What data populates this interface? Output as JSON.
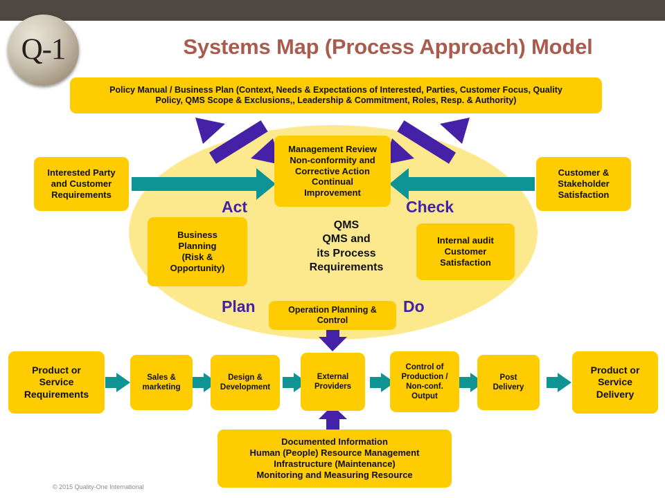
{
  "header": {
    "logo_text": "Q-1",
    "title": "Systems Map (Process Approach) Model"
  },
  "policy_box": {
    "line1": "Policy Manual / Business Plan (Context, Needs & Expectations of Interested, Parties, Customer Focus, Quality",
    "line2": "Policy, QMS Scope & Exclusions,, Leadership & Commitment, Roles, Resp. & Authority)"
  },
  "center": {
    "management_review": "Management Review\nNon-conformity and\nCorrective Action\nContinual\nImprovement",
    "qms_line1": "QMS",
    "qms_line2": "QMS and",
    "qms_line3": "its Process",
    "qms_line4": "Requirements"
  },
  "pdca": {
    "act": "Act",
    "check": "Check",
    "plan": "Plan",
    "do": "Do"
  },
  "side_boxes": {
    "interested_party": "Interested Party\nand Customer\nRequirements",
    "customer_satisfaction": "Customer &\nStakeholder\nSatisfaction",
    "business_planning": "Business\nPlanning\n(Risk &\nOpportunity)",
    "internal_audit": "Internal audit\nCustomer\nSatisfaction",
    "operation_planning": "Operation Planning &\nControl"
  },
  "process_chain": [
    {
      "label": "Product or\nService\nRequirements",
      "emphasis": "large"
    },
    {
      "label": "Sales &\nmarketing",
      "emphasis": "small"
    },
    {
      "label": "Design &\nDevelopment",
      "emphasis": "small"
    },
    {
      "label": "External\nProviders",
      "emphasis": "small"
    },
    {
      "label": "Control of\nProduction /\nNon-conf.\nOutput",
      "emphasis": "small"
    },
    {
      "label": "Post\nDelivery",
      "emphasis": "small"
    },
    {
      "label": "Product or\nService\nDelivery",
      "emphasis": "large"
    }
  ],
  "support_box": {
    "line1": "Documented Information",
    "line2": "Human (People) Resource Management",
    "line3": "Infrastructure (Maintenance)",
    "line4": "Monitoring and Measuring Resource"
  },
  "footer": {
    "copyright": "© 2015 Quality-One International"
  },
  "colors": {
    "header_bar": "#4F4742",
    "title_text": "#A85C4E",
    "box_fill": "#FFCC00",
    "ellipse_fill": "#FCE98E",
    "teal_arrow": "#0E9494",
    "purple_arrow": "#4421A6",
    "pdca_text": "#4421A6"
  }
}
